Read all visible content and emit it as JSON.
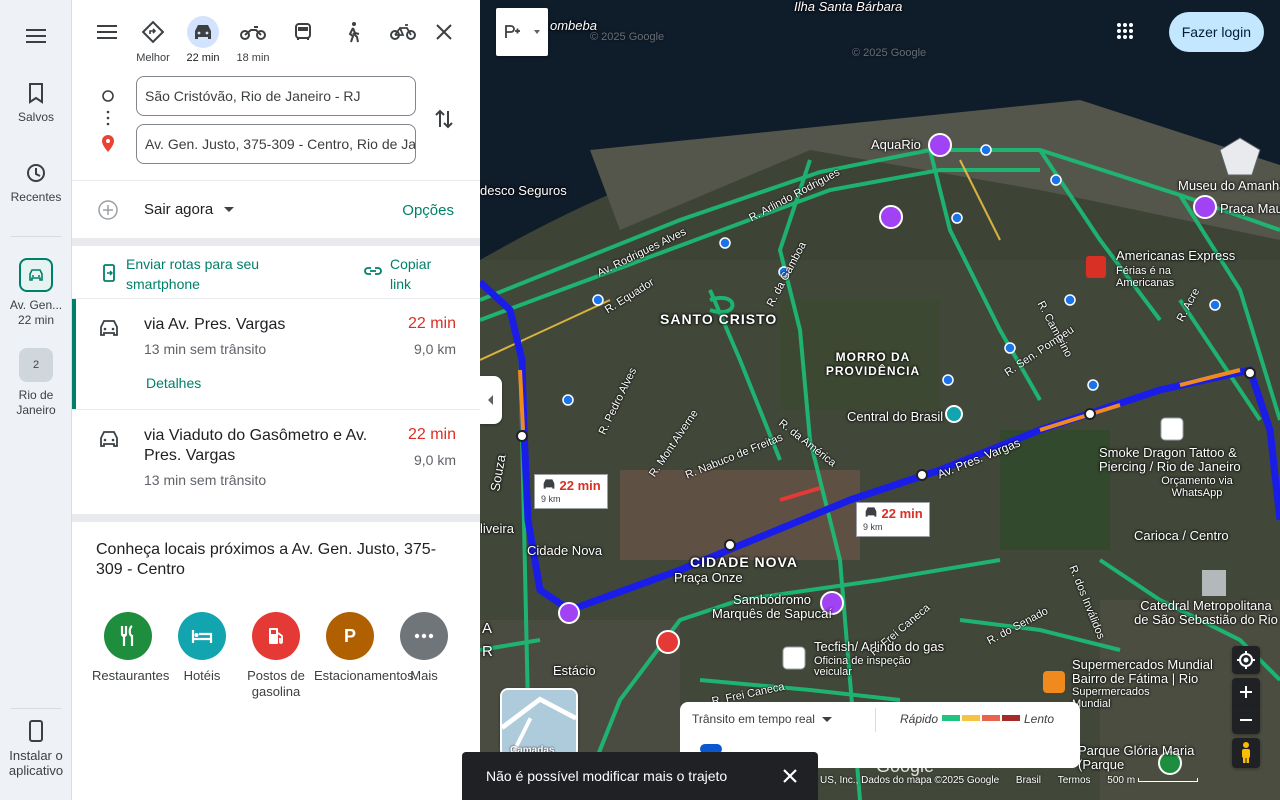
{
  "rail": {
    "saved": "Salvos",
    "recent": "Recentes",
    "route_label": "Av. Gen...",
    "route_time": "22 min",
    "place_count": "2",
    "place_label": "Rio de Janeiro",
    "install": "Instalar o aplicativo"
  },
  "modes": [
    {
      "label": "Melhor"
    },
    {
      "label": "22 min"
    },
    {
      "label": "18 min"
    },
    {
      "label": ""
    },
    {
      "label": ""
    },
    {
      "label": ""
    }
  ],
  "directions": {
    "origin": "São Cristóvão, Rio de Janeiro - RJ",
    "destination": "Av. Gen. Justo, 375-309 - Centro, Rio de Janeiro"
  },
  "depart": {
    "label": "Sair agora",
    "options": "Opções"
  },
  "share": {
    "send": "Enviar rotas para seu smartphone",
    "copy": "Copiar link"
  },
  "routes": [
    {
      "title": "via Av. Pres. Vargas",
      "time": "22 min",
      "sub": "13 min sem trânsito",
      "dist": "9,0 km",
      "details": "Detalhes"
    },
    {
      "title": "via Viaduto do Gasômetro e Av. Pres. Vargas",
      "time": "22 min",
      "sub": "13 min sem trânsito",
      "dist": "9,0 km"
    }
  ],
  "nearby": {
    "title": "Conheça locais próximos a Av. Gen. Justo, 375-309 - Centro",
    "categories": [
      {
        "label": "Restaurantes",
        "color": "#1e8e3e"
      },
      {
        "label": "Hotéis",
        "color": "#12a4af"
      },
      {
        "label": "Postos de gasolina",
        "color": "#e53935"
      },
      {
        "label": "Estacionamentos",
        "color": "#b06000"
      },
      {
        "label": "Mais",
        "color": "#70757a"
      }
    ]
  },
  "map": {
    "login": "Fazer login",
    "labels": {
      "santa_barbara": "Ilha Santa Bárbara",
      "gamboa_top": "ombeba",
      "bradesco": "desco Seguros",
      "aquario": "AquaRio",
      "museu": "Museu do Amanhã",
      "praca_maua": "Praça Mauá",
      "americanas": "Americanas Express",
      "americanas_sub": "Férias é na Americanas",
      "santo_cristo": "SANTO CRISTO",
      "morro": "MORRO DA PROVIDÊNCIA",
      "central": "Central do Brasil",
      "smoke": "Smoke Dragon Tattoo & Piercing / Rio de Janeiro",
      "smoke_sub": "Orçamento via WhatsApp",
      "carioca": "Carioca / Centro",
      "cidade_nova_area": "CIDADE NOVA",
      "cidade_nova_st": "Cidade Nova",
      "praca_onze": "Praça Onze",
      "sambodromo": "Sambódromo Marquês de Sapucaí",
      "catedral": "Catedral Metropolitana de São Sebastião do Rio",
      "tecfish": "Tecfish/ Arlindo do gas",
      "tecfish_sub": "Oficina de inspeção veicular",
      "supermercados": "Supermercados Mundial Bairro de Fátima | Rio",
      "supermercados_sub": "Supermercados Mundial",
      "estacio": "Estácio",
      "parque": "Parque Glória Maria (Parque",
      "oliveira": "liveira",
      "souza": "Souza",
      "letter_a": "A",
      "letter_r": "R"
    },
    "streets": {
      "pres_vargas": "Av. Pres. Vargas",
      "rodrigues_alves": "Av. Rodrigues Alves",
      "equador": "R. Equador",
      "arlindo": "R. Arlindo Rodrigues",
      "gamboa": "R. da Gamboa",
      "camerino": "R. Camerino",
      "pompeu": "R. Sen. Pompeu",
      "acre": "R. Acre",
      "pedro_alves": "R. Pedro Alves",
      "monte_alverne": "R. Mont Alverne",
      "nabuco": "R. Nabuco de Freitas",
      "america": "R. da América",
      "frei_caneca": "R. Frei Caneca",
      "frei_caneca2": "R. Frei Caneca",
      "senado": "R. do Senado",
      "invalidos": "R. dos Inválidos"
    },
    "bubble1": {
      "time": "22 min",
      "dist": "9 km"
    },
    "bubble2": {
      "time": "22 min",
      "dist": "9 km"
    },
    "watermark1": "© 2025 Google",
    "watermark2": "© 2025 Google",
    "layers": "Camadas",
    "traffic": {
      "title": "Trânsito em tempo real",
      "fast": "Rápido",
      "slow": "Lento",
      "colors": [
        "#1fc47f",
        "#f4c542",
        "#e8644b",
        "#a52a2a"
      ]
    },
    "toast": "Não é possível modificar mais o trajeto",
    "footer": {
      "credits": "US, Inc., Dados do mapa ©2025 Google",
      "country": "Brasil",
      "terms": "Termos",
      "scale": "500 m",
      "logo": "Google"
    }
  }
}
